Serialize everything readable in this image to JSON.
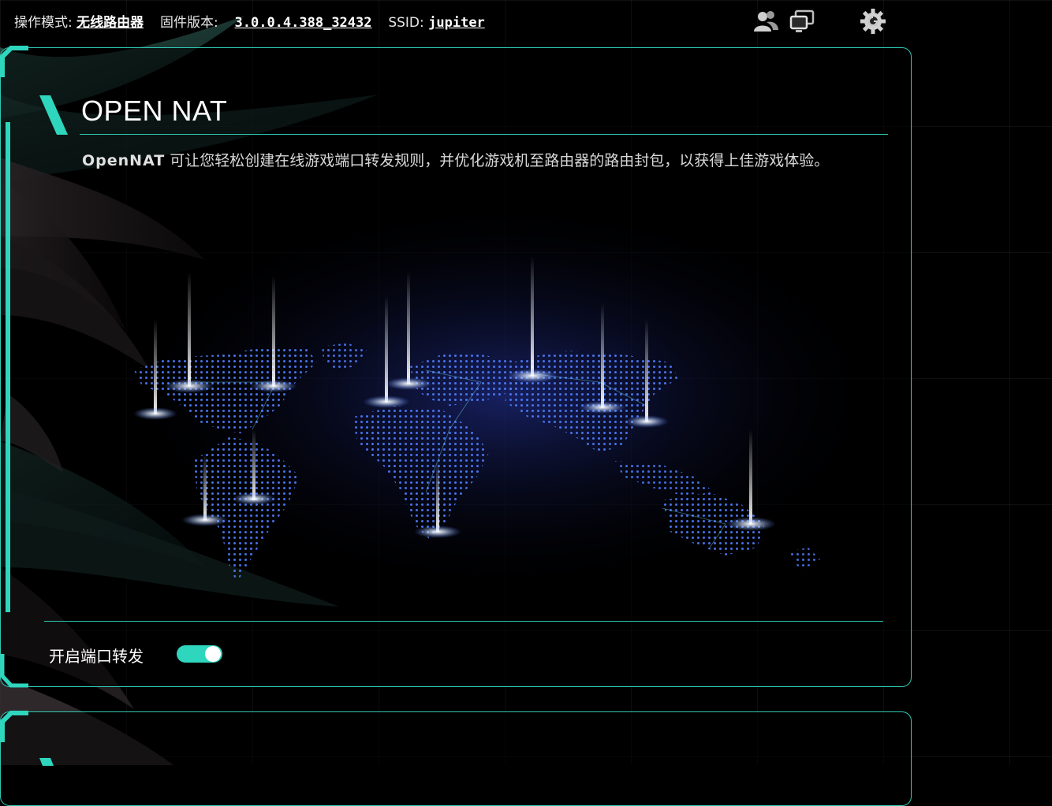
{
  "topbar": {
    "mode_label": "操作模式:",
    "mode_value": "无线路由器",
    "firmware_label": "固件版本:",
    "firmware_value": "3.0.0.4.388_32432",
    "ssid_label": "SSID:",
    "ssid_value": "jupiter",
    "icons": [
      "users-icon",
      "devices-icon",
      "settings-gear-icon"
    ]
  },
  "section": {
    "title": "OPEN NAT",
    "description_brand": "OpenNAT",
    "description_text": " 可让您轻松创建在线游戏端口转发规则，并优化游戏机至路由器的路由封包，以获得上佳游戏体验。",
    "image": "world-map-network-image"
  },
  "toggle": {
    "label": "开启端口转发",
    "state": "on"
  },
  "colors": {
    "accent": "#2fd6be",
    "background": "#000000",
    "text": "#ffffff"
  }
}
